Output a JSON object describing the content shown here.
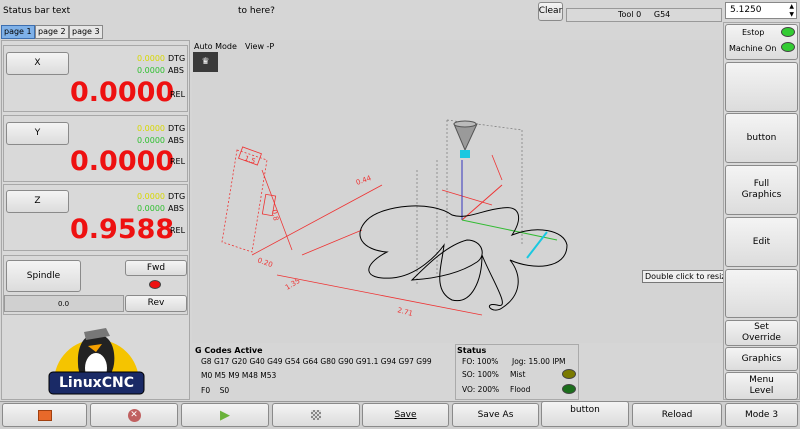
{
  "top": {
    "status_text": "Status bar text",
    "to_here": "to here?",
    "clear_label": "Clear",
    "tool_text": "Tool 0     G54",
    "spin_value": "5.1250"
  },
  "tabs": [
    "page 1",
    "page 2",
    "page 3"
  ],
  "axes": [
    {
      "name": "X",
      "dtg_yellow": "0.0000",
      "dtg": "DTG",
      "abs_value": "0.0000",
      "abs": "ABS",
      "rel_value": "0.0000",
      "rel": "REL"
    },
    {
      "name": "Y",
      "dtg_yellow": "0.0000",
      "dtg": "DTG",
      "abs_value": "0.0000",
      "abs": "ABS",
      "rel_value": "0.0000",
      "rel": "REL"
    },
    {
      "name": "Z",
      "dtg_yellow": "0.0000",
      "dtg": "DTG",
      "abs_value": "0.0000",
      "abs": "ABS",
      "rel_value": "0.9588",
      "rel": "REL"
    }
  ],
  "spindle": {
    "label": "Spindle",
    "fwd": "Fwd",
    "rev": "Rev",
    "speed": "0.0"
  },
  "logo_text": "LinuxCNC",
  "graphics": {
    "mode": "Auto Mode",
    "view": "View -P",
    "tooltip": "Double click to resize Graphics",
    "dims": [
      "1.5",
      "0.8",
      "0.20",
      "1.35",
      "2.71",
      "0.44"
    ]
  },
  "gcodes": {
    "title": "G Codes Active",
    "line1": "G8 G17 G20 G40 G49 G54 G64 G80 G90 G91.1 G94 G97 G99",
    "line2": "M0 M5 M9 M48 M53",
    "line3": "F0    S0"
  },
  "status": {
    "title": "Status",
    "fo": "FO: 100%",
    "jog": "Jog: 15.00 IPM",
    "so": "SO: 100%",
    "mist": "Mist",
    "vo": "VO: 200%",
    "flood": "Flood"
  },
  "right_buttons": {
    "estop": "Estop",
    "machine_on": "Machine On",
    "button": "button",
    "full_graphics": "Full\nGraphics",
    "edit": "Edit",
    "set_override": "Set\nOverride",
    "graphics": "Graphics",
    "menu_level": "Menu\nLevel",
    "mode": "Mode 3"
  },
  "bottom_buttons": {
    "save": "Save",
    "save_as": "Save As",
    "button": "button",
    "reload": "Reload"
  },
  "colors": {
    "led_green": "#33cc33",
    "led_red": "#ee1111",
    "led_olive": "#7a7a00",
    "led_dkgreen": "#1b6e1b",
    "dro_red": "#ee1111"
  }
}
